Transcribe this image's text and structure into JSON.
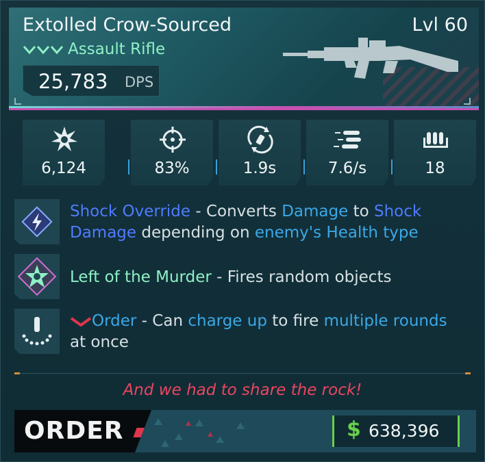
{
  "header": {
    "title": "Extolled Crow-Sourced",
    "level": "Lvl 60",
    "weapon_type": "Assault Rifle",
    "dps_value": "25,783",
    "dps_unit": "DPS",
    "rarity_icon": "rarity-chevrons-icon",
    "weapon_icon": "assault-rifle-icon"
  },
  "stats": [
    {
      "icon": "damage-burst-icon",
      "value": "6,124"
    },
    {
      "icon": "crosshair-icon",
      "value": "83%"
    },
    {
      "icon": "reload-icon",
      "value": "1.9s"
    },
    {
      "icon": "fire-rate-icon",
      "value": "7.6/s"
    },
    {
      "icon": "magazine-icon",
      "value": "18"
    }
  ],
  "perks": [
    {
      "icon": "shock-element-icon",
      "name": "Shock Override",
      "sep": " - ",
      "t1": "Converts ",
      "k1": "Damage",
      "t2": " to ",
      "k2": "Shock",
      "k3": "Damage",
      "t3": " depending on ",
      "k4": "enemy's Health type"
    },
    {
      "icon": "star-badge-icon",
      "name": "Left of the Murder",
      "sep": " - ",
      "t1": "Fires random objects"
    },
    {
      "icon": "charge-rounds-icon",
      "name": "Order",
      "sep": " - ",
      "t1": "Can ",
      "k1": "charge up",
      "t2": " to fire ",
      "k2": "multiple rounds",
      "t3": "at once"
    }
  ],
  "flavor_text": "And we had to share the rock!",
  "footer": {
    "brand": "ORDER",
    "currency_symbol": "$",
    "price": "638,396"
  },
  "colors": {
    "accent_green": "#8ff0c6",
    "keyword_blue": "#4f7cff",
    "keyword_cyan": "#3ba8e6",
    "flavor_red": "#ec4560",
    "price_green": "#68d04b"
  }
}
